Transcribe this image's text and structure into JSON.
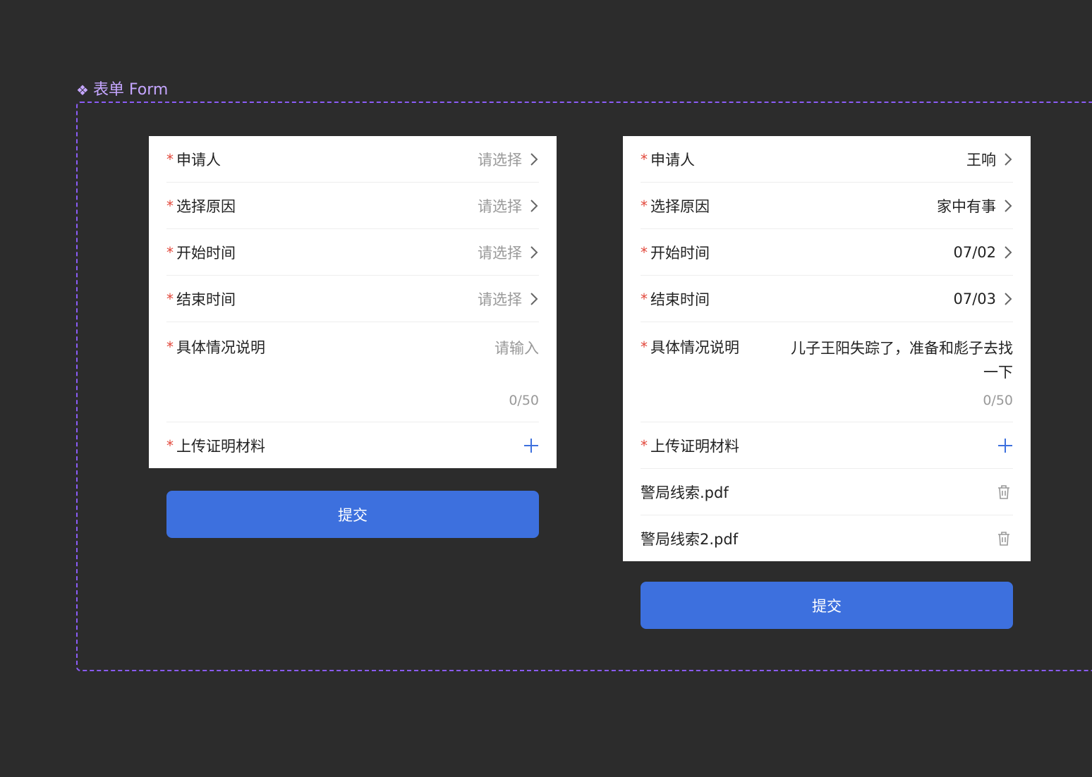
{
  "frame": {
    "title": "表单 Form",
    "icon": "component-icon"
  },
  "colors": {
    "accent": "#3d70de",
    "required": "#e2483c",
    "frame_border": "#8b5cf6",
    "placeholder": "#999999"
  },
  "left_form": {
    "applicant": {
      "label": "申请人",
      "value": "请选择"
    },
    "reason": {
      "label": "选择原因",
      "value": "请选择"
    },
    "start_time": {
      "label": "开始时间",
      "value": "请选择"
    },
    "end_time": {
      "label": "结束时间",
      "value": "请选择"
    },
    "description": {
      "label": "具体情况说明",
      "placeholder": "请输入",
      "counter": "0/50"
    },
    "upload": {
      "label": "上传证明材料"
    },
    "submit_label": "提交"
  },
  "right_form": {
    "applicant": {
      "label": "申请人",
      "value": "王响"
    },
    "reason": {
      "label": "选择原因",
      "value": "家中有事"
    },
    "start_time": {
      "label": "开始时间",
      "value": "07/02"
    },
    "end_time": {
      "label": "结束时间",
      "value": "07/03"
    },
    "description": {
      "label": "具体情况说明",
      "value": "儿子王阳失踪了，准备和彪子去找一下",
      "counter": "0/50"
    },
    "upload": {
      "label": "上传证明材料"
    },
    "files": [
      {
        "name": "警局线索.pdf"
      },
      {
        "name": "警局线索2.pdf"
      }
    ],
    "submit_label": "提交"
  }
}
